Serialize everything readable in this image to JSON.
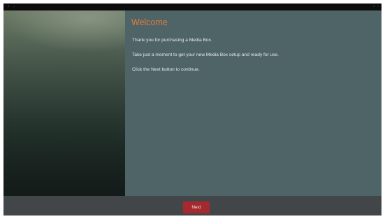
{
  "statusbar": {
    "left_icons": [
      "notification-icon",
      "settings-icon"
    ],
    "right_icons": [
      "wifi-icon",
      "clock-icon"
    ]
  },
  "welcome": {
    "title": "Welcome",
    "paragraphs": [
      "Thank you for purchasing a Media Box.",
      "Take just a moment to get your new Media Box setup and ready for use.",
      "Click the Next button to continue."
    ]
  },
  "footer": {
    "next_label": "Next"
  },
  "colors": {
    "title": "#e07c3e",
    "content_bg": "#4f6467",
    "footer_bg": "#434649",
    "button_bg": "#a42a2f"
  }
}
